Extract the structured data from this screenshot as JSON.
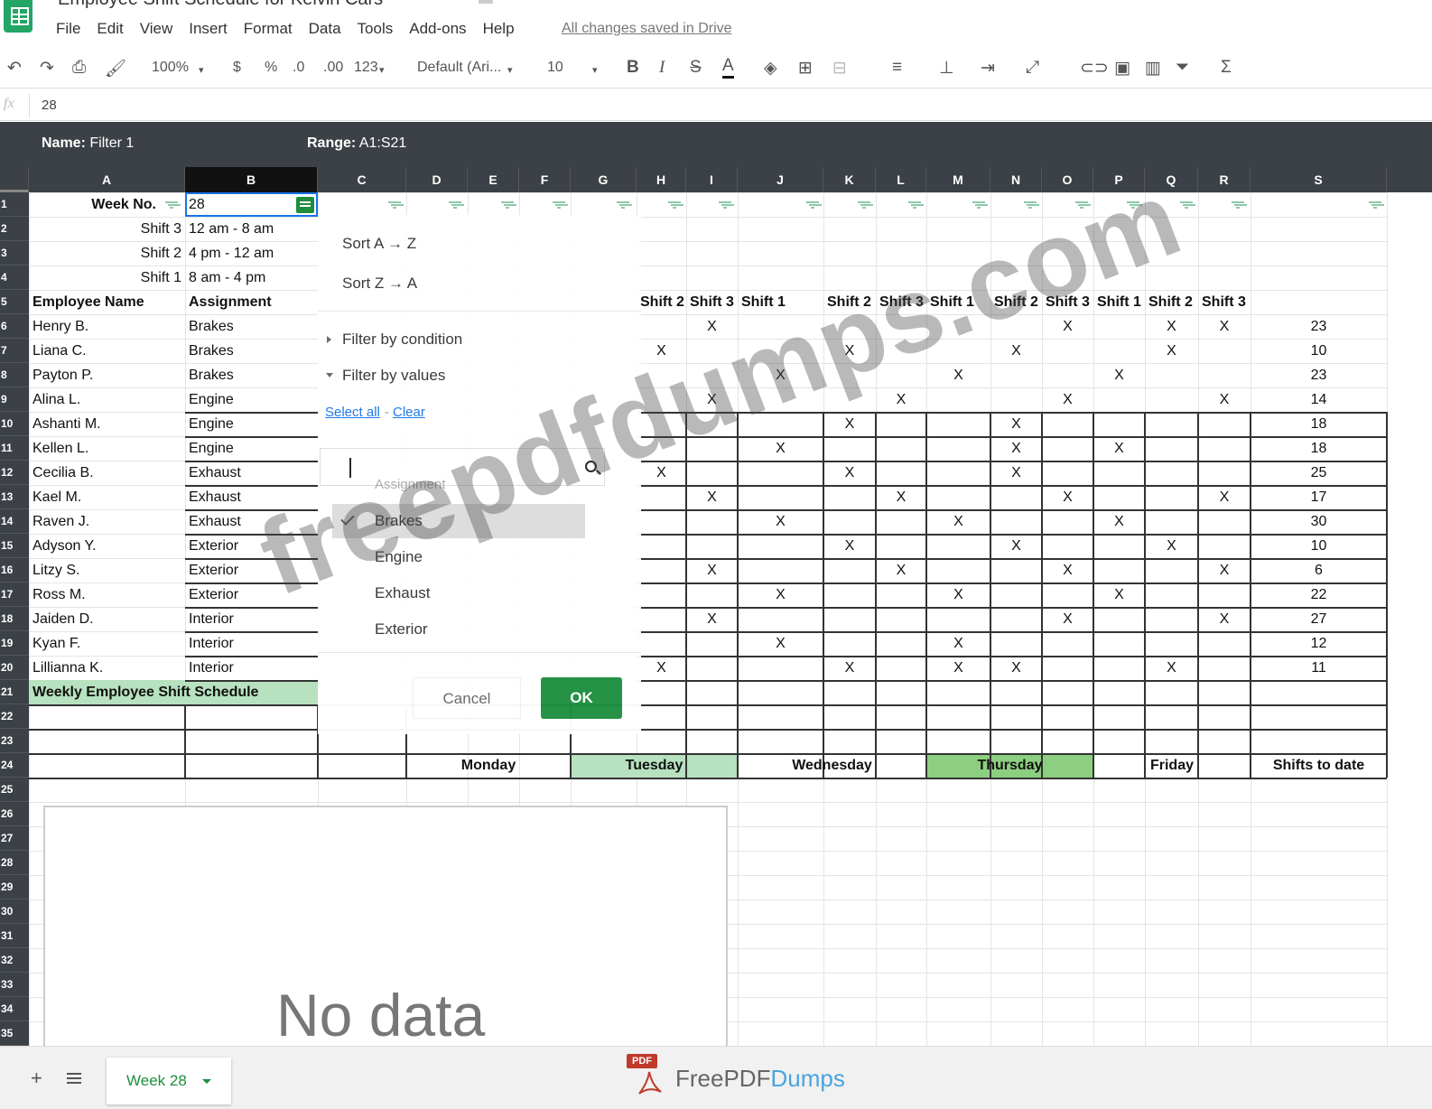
{
  "window": {
    "title": "Employee Shift Schedule for Kelvin Cars",
    "menu": [
      "File",
      "Edit",
      "View",
      "Insert",
      "Format",
      "Data",
      "Tools",
      "Add-ons",
      "Help"
    ],
    "saved_status": "All changes saved in Drive"
  },
  "toolbar": {
    "zoom": "100%",
    "currency": "$",
    "percent": "%",
    "decrease_decimal": ".0",
    "increase_decimal": ".00",
    "number_format": "123",
    "font": "Default (Ari...",
    "font_size": "10",
    "bold": "B",
    "italic": "I",
    "strike": "S",
    "text_color": "A",
    "sum": "Σ"
  },
  "formula_bar": {
    "fx": "fx",
    "value": "28"
  },
  "filter_bar": {
    "name_label": "Name:",
    "name": "Filter 1",
    "range_label": "Range:",
    "range": "A1:S21"
  },
  "columns": [
    "A",
    "B",
    "C",
    "D",
    "E",
    "F",
    "G",
    "H",
    "I",
    "J",
    "K",
    "L",
    "M",
    "N",
    "O",
    "P",
    "Q",
    "R",
    "S"
  ],
  "rows": [
    "1",
    "2",
    "3",
    "4",
    "5",
    "6",
    "7",
    "8",
    "9",
    "10",
    "11",
    "12",
    "13",
    "14",
    "15",
    "16",
    "17",
    "18",
    "19",
    "20",
    "21",
    "22",
    "23",
    "24",
    "25",
    "26",
    "27",
    "28",
    "29",
    "30",
    "31",
    "32",
    "33",
    "34",
    "35"
  ],
  "sheet": {
    "week_label": "Week No.",
    "week_value": "28",
    "shift_defs": [
      {
        "name": "Shift 3",
        "time": "12 am - 8 am"
      },
      {
        "name": "Shift 2",
        "time": "4 pm - 12 am"
      },
      {
        "name": "Shift 1",
        "time": "8 am - 4 pm"
      }
    ],
    "header_employee": "Employee Name",
    "header_assignment": "Assignment",
    "shift_headers": [
      "Shift 2",
      "Shift 3",
      "Shift 1",
      "Shift 2",
      "Shift 3",
      "Shift 1",
      "Shift 2",
      "Shift 3",
      "Shift 1",
      "Shift 2",
      "Shift 3"
    ],
    "employees": [
      {
        "name": "Henry B.",
        "assignment": "Brakes",
        "total": "23"
      },
      {
        "name": "Liana C.",
        "assignment": "Brakes",
        "total": "10"
      },
      {
        "name": "Payton P.",
        "assignment": "Brakes",
        "total": "23"
      },
      {
        "name": "Alina L.",
        "assignment": "Engine",
        "total": "14"
      },
      {
        "name": "Ashanti M.",
        "assignment": "Engine",
        "total": "18"
      },
      {
        "name": "Kellen L.",
        "assignment": "Engine",
        "total": "18"
      },
      {
        "name": "Cecilia B.",
        "assignment": "Exhaust",
        "total": "25"
      },
      {
        "name": "Kael M.",
        "assignment": "Exhaust",
        "total": "17"
      },
      {
        "name": "Raven J.",
        "assignment": "Exhaust",
        "total": "30"
      },
      {
        "name": "Adyson Y.",
        "assignment": "Exterior",
        "total": "10"
      },
      {
        "name": "Litzy S.",
        "assignment": "Exterior",
        "total": "6"
      },
      {
        "name": "Ross M.",
        "assignment": "Exterior",
        "total": "22"
      },
      {
        "name": "Jaiden D.",
        "assignment": "Interior",
        "total": "27"
      },
      {
        "name": "Kyan F.",
        "assignment": "Interior",
        "total": "12"
      },
      {
        "name": "Lillianna K.",
        "assignment": "Interior",
        "total": "11"
      }
    ],
    "mark": "X",
    "marks": [
      [
        "I",
        "O",
        "Q",
        "R"
      ],
      [
        "H",
        "K",
        "N",
        "Q"
      ],
      [
        "J",
        "M",
        "P"
      ],
      [
        "I",
        "L",
        "O",
        "R"
      ],
      [
        "K",
        "N"
      ],
      [
        "J",
        "N",
        "P"
      ],
      [
        "H",
        "K",
        "N"
      ],
      [
        "I",
        "L",
        "O",
        "R"
      ],
      [
        "J",
        "M",
        "P"
      ],
      [
        "K",
        "N",
        "Q"
      ],
      [
        "I",
        "L",
        "O",
        "R"
      ],
      [
        "J",
        "M",
        "P"
      ],
      [
        "I",
        "O",
        "R"
      ],
      [
        "J",
        "M"
      ],
      [
        "H",
        "K",
        "M",
        "N",
        "Q"
      ]
    ],
    "summary_label": "Weekly Employee Shift Schedule",
    "days": [
      "Monday",
      "Tuesday",
      "Wednesday",
      "Thursday",
      "Friday"
    ],
    "shifts_to_date": "Shifts to date"
  },
  "filter_menu": {
    "sort_az": "Sort A → Z",
    "sort_za": "Sort Z → A",
    "filter_condition": "Filter by condition",
    "filter_values": "Filter by values",
    "select_all": "Select all",
    "separator": "-",
    "clear": "Clear",
    "hidden_value": "Assignment",
    "values": [
      {
        "label": "Brakes",
        "checked": true
      },
      {
        "label": "Engine",
        "checked": false
      },
      {
        "label": "Exhaust",
        "checked": false
      },
      {
        "label": "Exterior",
        "checked": false
      }
    ],
    "cancel": "Cancel",
    "ok": "OK"
  },
  "chart": {
    "placeholder": "No data"
  },
  "bottom": {
    "add": "+",
    "sheet_tab": "Week 28",
    "brand_badge": "PDF",
    "brand_main": "FreePDF",
    "brand_accent": "Dumps"
  },
  "watermark": "freepdfdumps.com",
  "colors": {
    "green": "#1e8e3e",
    "light_green": "#b7e1bf",
    "header_dark": "#3b4146"
  }
}
